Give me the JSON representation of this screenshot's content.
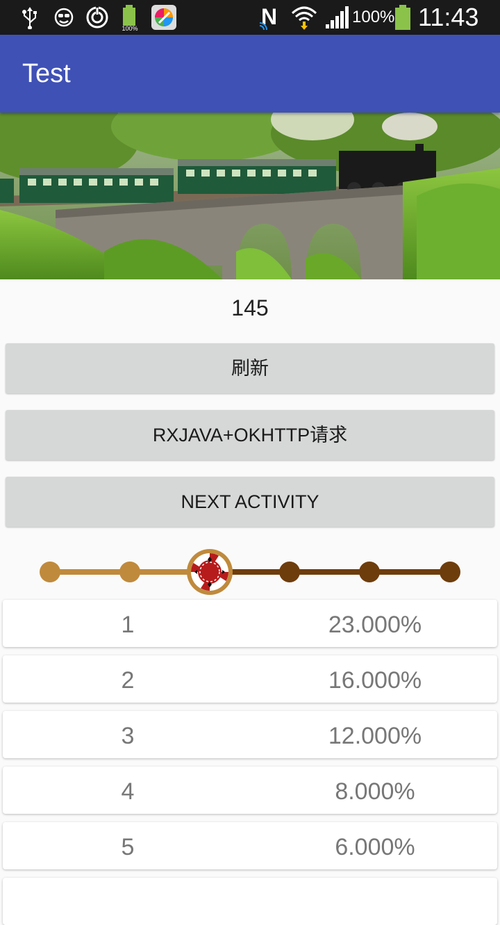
{
  "status_bar": {
    "battery_percent": "100%",
    "time": "11:43",
    "app_badge": "100%"
  },
  "app_bar": {
    "title": "Test"
  },
  "counter": "145",
  "buttons": {
    "refresh": "刷新",
    "rxjava_okhttp": "RXJAVA+OKHTTP请求",
    "next_activity": "NEXT ACTIVITY"
  },
  "stepper": {
    "total_steps": 6,
    "current_step": 3
  },
  "list": [
    {
      "rank": "1",
      "percent": "23.000%"
    },
    {
      "rank": "2",
      "percent": "16.000%"
    },
    {
      "rank": "3",
      "percent": "12.000%"
    },
    {
      "rank": "4",
      "percent": "8.000%"
    },
    {
      "rank": "5",
      "percent": "6.000%"
    },
    {
      "rank": "",
      "percent": ""
    }
  ]
}
